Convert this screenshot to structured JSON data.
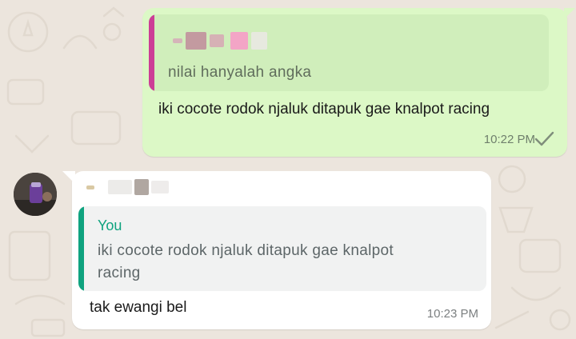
{
  "outgoing": {
    "quoted_text": "nilai hanyalah angka",
    "text": "iki cocote rodok njaluk ditapuk gae knalpot racing",
    "time": "10:22 PM",
    "status_icon": "single-check-icon"
  },
  "incoming": {
    "quoted_author": "You",
    "quoted_text": "iki cocote rodok njaluk ditapuk gae knalpot racing",
    "text": "tak ewangi bel",
    "time": "10:23 PM"
  },
  "colors": {
    "outgoing_bubble": "#dcf8c6",
    "incoming_bubble": "#ffffff",
    "quote_bar_pink": "#cc3e96",
    "quote_bar_green": "#0fa37f",
    "background": "#ece5dd"
  }
}
